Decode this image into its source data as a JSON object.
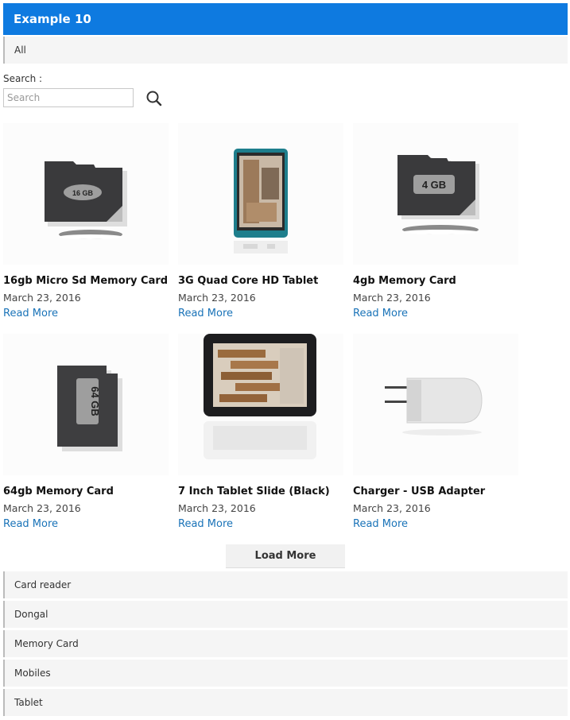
{
  "header": {
    "title": "Example 10"
  },
  "filter_all": {
    "label": "All"
  },
  "search": {
    "label": "Search :",
    "placeholder": "Search",
    "value": ""
  },
  "products": [
    {
      "title": "16gb Micro Sd Memory Card",
      "date": "March 23, 2016",
      "link": "Read More",
      "badge": "16 GB"
    },
    {
      "title": "3G Quad Core HD Tablet",
      "date": "March 23, 2016",
      "link": "Read More"
    },
    {
      "title": "4gb Memory Card",
      "date": "March 23, 2016",
      "link": "Read More",
      "badge": "4 GB"
    },
    {
      "title": "64gb Memory Card",
      "date": "March 23, 2016",
      "link": "Read More",
      "badge": "64 GB"
    },
    {
      "title": "7 Inch Tablet Slide (Black)",
      "date": "March 23, 2016",
      "link": "Read More"
    },
    {
      "title": "Charger - USB Adapter",
      "date": "March 23, 2016",
      "link": "Read More"
    }
  ],
  "load_more": {
    "label": "Load More"
  },
  "categories": [
    {
      "label": "Card reader"
    },
    {
      "label": "Dongal"
    },
    {
      "label": "Memory Card"
    },
    {
      "label": "Mobiles"
    },
    {
      "label": "Tablet"
    }
  ],
  "colors": {
    "header_bg": "#0e7ae0",
    "link": "#1a73b8"
  }
}
